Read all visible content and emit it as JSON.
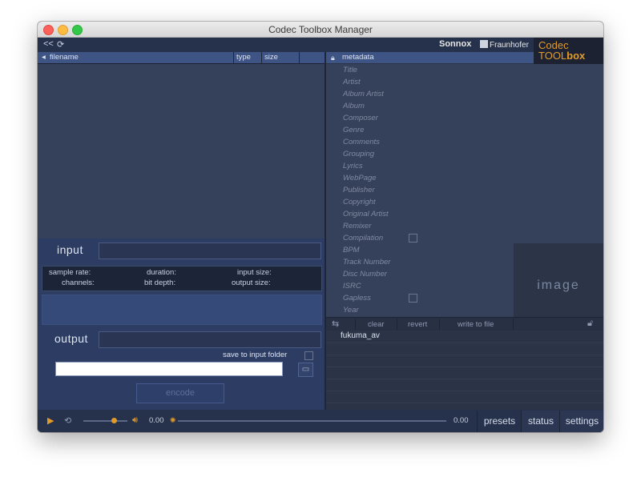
{
  "window": {
    "title": "Codec Toolbox Manager"
  },
  "toolbar": {
    "back_icon": "<<",
    "refresh_icon": "⟳"
  },
  "brands": {
    "sonnox": "Sonnox",
    "fraunhofer": "Fraunhofer",
    "codec_line1": "Codec",
    "codec_line2a": "TOOL",
    "codec_line2b": "box"
  },
  "file_table": {
    "columns": [
      "filename",
      "type",
      "size"
    ]
  },
  "metadata": {
    "header": "metadata",
    "fields": [
      "Title",
      "Artist",
      "Album Artist",
      "Album",
      "Composer",
      "Genre",
      "Comments",
      "Grouping",
      "Lyrics",
      "WebPage",
      "Publisher",
      "Copyright",
      "Original Artist",
      "Remixer",
      "Compilation",
      "BPM",
      "Track Number",
      "Disc Number",
      "ISRC",
      "Gapless",
      "Year"
    ],
    "image_label": "image",
    "buttons": {
      "clear": "clear",
      "revert": "revert",
      "write": "write to file"
    },
    "list_items": [
      "fukuma_av"
    ]
  },
  "input": {
    "label": "input",
    "info": {
      "sample_rate": "sample rate:",
      "duration": "duration:",
      "input_size": "input size:",
      "channels": "channels:",
      "bit_depth": "bit depth:",
      "output_size": "output size:"
    }
  },
  "output": {
    "label": "output",
    "save_to_input_folder": "save to input folder",
    "path_value": ""
  },
  "encode_button": "encode",
  "player": {
    "time_current": "0.00",
    "time_total": "0.00"
  },
  "tabs": [
    "presets",
    "status",
    "settings"
  ],
  "colors": {
    "accent": "#e39a29",
    "panel": "#35405a",
    "header": "#3e5485"
  }
}
